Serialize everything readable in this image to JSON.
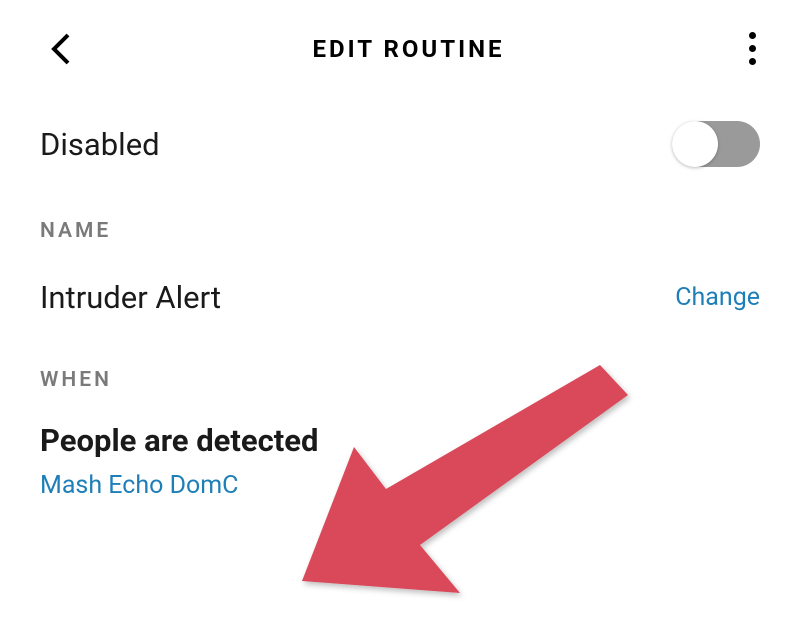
{
  "header": {
    "title": "EDIT ROUTINE"
  },
  "status": {
    "label": "Disabled"
  },
  "sections": {
    "name_label": "NAME",
    "when_label": "WHEN"
  },
  "routine": {
    "name": "Intruder Alert",
    "change_label": "Change"
  },
  "trigger": {
    "title": "People are detected",
    "device": "Mash Echo DomC"
  },
  "colors": {
    "link": "#1e7fb8",
    "arrow": "#d94a5a"
  }
}
